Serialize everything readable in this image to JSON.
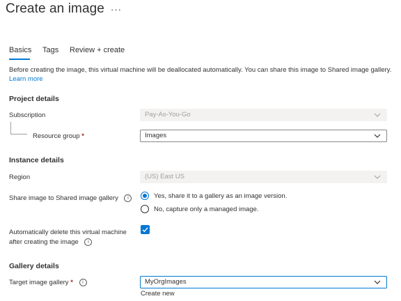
{
  "header": {
    "title": "Create an image",
    "more": "···"
  },
  "tabs": [
    {
      "label": "Basics"
    },
    {
      "label": "Tags"
    },
    {
      "label": "Review + create"
    }
  ],
  "description": {
    "text": "Before creating the image, this virtual machine will be deallocated automatically. You can share this image to Shared image gallery.",
    "link": "Learn more"
  },
  "project": {
    "heading": "Project details",
    "subscription_label": "Subscription",
    "subscription_value": "Pay-As-You-Go",
    "resource_group_label": "Resource group",
    "resource_group_value": "Images",
    "required": "*"
  },
  "instance": {
    "heading": "Instance details",
    "region_label": "Region",
    "region_value": "(US) East US",
    "share_label": "Share image to Shared image gallery",
    "share_options": [
      {
        "label": "Yes, share it to a gallery as an image version.",
        "checked": true
      },
      {
        "label": "No, capture only a managed image.",
        "checked": false
      }
    ],
    "auto_delete_label_1": "Automatically delete this virtual machine",
    "auto_delete_label_2": "after creating the image",
    "auto_delete_checked": true,
    "info": "i"
  },
  "gallery": {
    "heading": "Gallery details",
    "target_label": "Target image gallery",
    "target_value": "MyOrgImages",
    "create_new": "Create new",
    "required": "*"
  },
  "colors": {
    "accent": "#0078d4",
    "required": "#a4262c",
    "disabled_bg": "#f3f2f1"
  }
}
